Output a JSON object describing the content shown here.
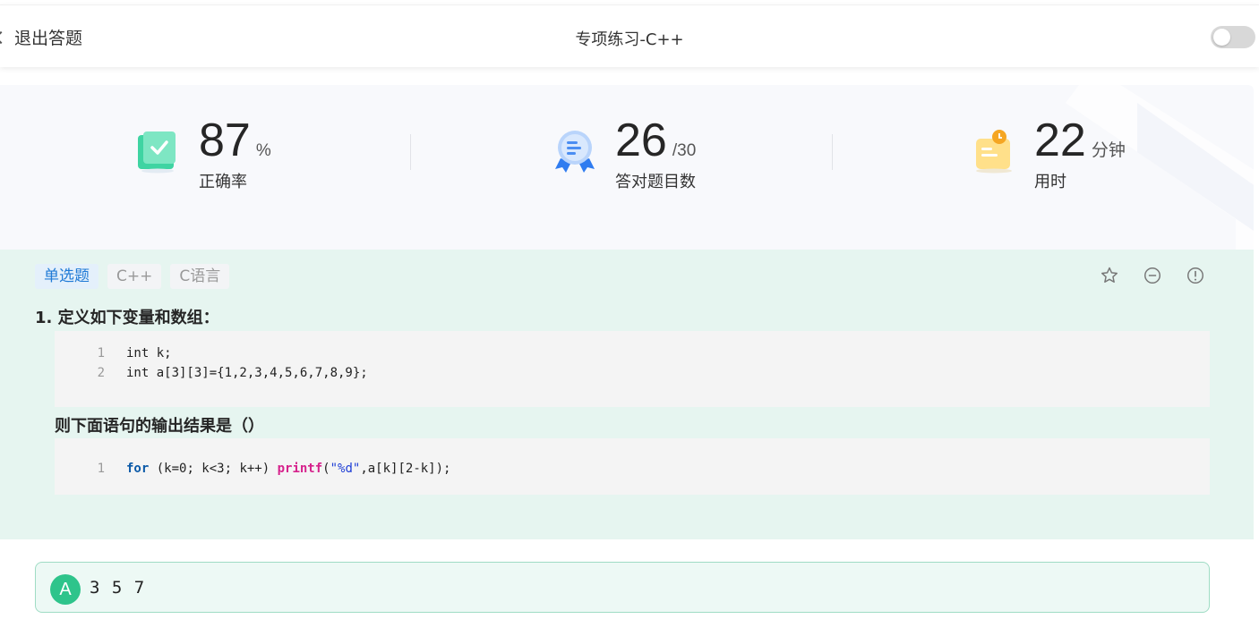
{
  "header": {
    "back_label": "退出答题",
    "title": "专项练习-C++"
  },
  "stats": {
    "accuracy": {
      "value": "87",
      "unit": "%",
      "label": "正确率"
    },
    "correct": {
      "value": "26",
      "unit": "/30",
      "label": "答对题目数"
    },
    "time": {
      "value": "22",
      "unit": "分钟",
      "label": "用时"
    }
  },
  "question": {
    "tags": [
      "单选题",
      "C++",
      "C语言"
    ],
    "title": "1. 定义如下变量和数组：",
    "code1": [
      {
        "ln": "1",
        "text": "int k;"
      },
      {
        "ln": "2",
        "text": "int a[3][3]={1,2,3,4,5,6,7,8,9};"
      }
    ],
    "subtitle": "则下面语句的输出结果是（）",
    "code2": {
      "ln": "1",
      "kw": "for",
      "p1": " (k=0; k<3; k++) ",
      "fn": "printf",
      "p2": "(",
      "str": "\"%d\"",
      "p3": ",a[k][2-k]);"
    }
  },
  "options": [
    {
      "letter": "A",
      "text": "3 5 7"
    }
  ],
  "colors": {
    "accent_green": "#2ec48b",
    "question_bg": "#e6f5f0",
    "tag_blue": "#1f7ad6"
  }
}
